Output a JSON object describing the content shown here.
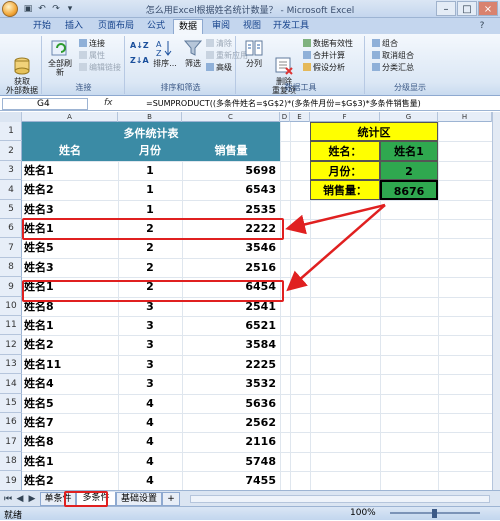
{
  "window": {
    "title": "怎么用Excel根据姓名统计数量？ - Microsoft Excel"
  },
  "ribbon_tabs": [
    "开始",
    "插入",
    "页面布局",
    "公式",
    "数据",
    "审阅",
    "视图",
    "开发工具"
  ],
  "active_tab": "数据",
  "ribbon": {
    "get_external": "获取\n外部数据",
    "refresh_all": "全部刷新",
    "connections": "连接",
    "properties": "属性",
    "edit_links": "编辑链接",
    "group_connections": "连接",
    "sort": "排序...",
    "filter": "筛选",
    "clear": "清除",
    "reapply": "重新应用",
    "advanced": "高级",
    "group_sort": "排序和筛选",
    "text_to_columns": "分列",
    "remove_dup": "删除\n重复项",
    "data_validation": "数据有效性",
    "consolidate": "合并计算",
    "whatif": "假设分析",
    "group_tools": "数据工具",
    "group_btn": "组合",
    "ungroup_btn": "取消组合",
    "subtotal": "分类汇总",
    "group_outline": "分级显示"
  },
  "formula_bar": {
    "name_box": "G4",
    "fx": "fx",
    "formula": "=SUMPRODUCT((多条件姓名=$G$2)*(多条件月份=$G$3)*多条件销售量)"
  },
  "columns": [
    "A",
    "B",
    "C",
    "D",
    "E",
    "F",
    "G",
    "H"
  ],
  "rows": [
    "1",
    "2",
    "3",
    "4",
    "5",
    "6",
    "7",
    "8",
    "9",
    "10",
    "11",
    "12",
    "13",
    "14",
    "15",
    "16",
    "17",
    "18",
    "19"
  ],
  "table": {
    "title": "多件统计表",
    "headers": [
      "姓名",
      "月份",
      "销售量"
    ],
    "data": [
      [
        "姓名1",
        "1",
        "5698"
      ],
      [
        "姓名2",
        "1",
        "6543"
      ],
      [
        "姓名3",
        "1",
        "2535"
      ],
      [
        "姓名1",
        "2",
        "2222"
      ],
      [
        "姓名5",
        "2",
        "3546"
      ],
      [
        "姓名3",
        "2",
        "2516"
      ],
      [
        "姓名1",
        "2",
        "6454"
      ],
      [
        "姓名8",
        "3",
        "2541"
      ],
      [
        "姓名1",
        "3",
        "6521"
      ],
      [
        "姓名2",
        "3",
        "3584"
      ],
      [
        "姓名11",
        "3",
        "2225"
      ],
      [
        "姓名4",
        "3",
        "3532"
      ],
      [
        "姓名5",
        "4",
        "5636"
      ],
      [
        "姓名7",
        "4",
        "2562"
      ],
      [
        "姓名8",
        "4",
        "2116"
      ],
      [
        "姓名1",
        "4",
        "5748"
      ],
      [
        "姓名2",
        "4",
        "7455"
      ]
    ]
  },
  "stats": {
    "title": "统计区",
    "name_label": "姓名：",
    "name_value": "姓名1",
    "month_label": "月份：",
    "month_value": "2",
    "sales_label": "销售量：",
    "sales_value": "8676"
  },
  "sheet_tabs": [
    "单条件",
    "多条件",
    "基础设置"
  ],
  "active_sheet": "多条件",
  "status": {
    "ready": "就绪",
    "zoom": "100%"
  },
  "colors": {
    "header_teal": "#3b8ba5",
    "stats_yellow": "#ffff00",
    "stats_green": "#2fa84f",
    "highlight_red": "#e02020"
  }
}
